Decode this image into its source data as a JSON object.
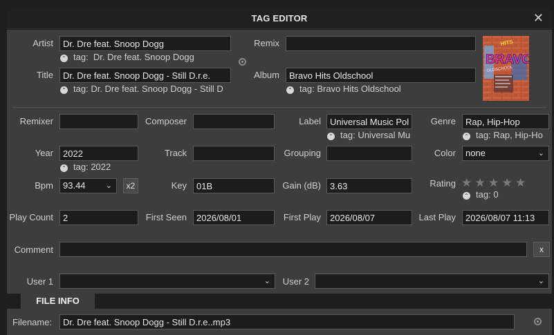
{
  "window": {
    "title": "TAG EDITOR",
    "close_glyph": "✕"
  },
  "tag_prefix": "tag:",
  "fields": {
    "artist": {
      "label": "Artist",
      "value": "Dr. Dre feat. Snoop Dogg",
      "tag": "Dr. Dre feat. Snoop Dogg"
    },
    "remix": {
      "label": "Remix",
      "value": ""
    },
    "title": {
      "label": "Title",
      "value": "Dr. Dre feat. Snoop Dogg - Still D.r.e.",
      "tag": "Dr. Dre feat. Snoop Dogg - Still D"
    },
    "album": {
      "label": "Album",
      "value": "Bravo Hits Oldschool",
      "tag": "Bravo Hits Oldschool"
    },
    "remixer": {
      "label": "Remixer",
      "value": ""
    },
    "composer": {
      "label": "Composer",
      "value": ""
    },
    "label": {
      "label": "Label",
      "value": "Universal Music Pol",
      "tag": "Universal Mu"
    },
    "genre": {
      "label": "Genre",
      "value": "Rap, Hip-Hop",
      "tag": "Rap, Hip-Ho"
    },
    "year": {
      "label": "Year",
      "value": "2022",
      "tag": "2022"
    },
    "track": {
      "label": "Track",
      "value": ""
    },
    "grouping": {
      "label": "Grouping",
      "value": ""
    },
    "color": {
      "label": "Color",
      "value": "none"
    },
    "bpm": {
      "label": "Bpm",
      "value": "93.44",
      "x2": "x2"
    },
    "key": {
      "label": "Key",
      "value": "01B"
    },
    "gain": {
      "label": "Gain (dB)",
      "value": "3.63"
    },
    "rating": {
      "label": "Rating",
      "stars": 0,
      "max_stars": 5,
      "tag": "0"
    },
    "play_count": {
      "label": "Play Count",
      "value": "2"
    },
    "first_seen": {
      "label": "First Seen",
      "value": "2026/08/01"
    },
    "first_play": {
      "label": "First Play",
      "value": "2026/08/07"
    },
    "last_play": {
      "label": "Last Play",
      "value": "2026/08/07 11:13"
    },
    "comment": {
      "label": "Comment",
      "value": "",
      "clear": "x"
    },
    "user1": {
      "label": "User 1",
      "value": ""
    },
    "user2": {
      "label": "User 2",
      "value": ""
    }
  },
  "file_info": {
    "tab_label": "FILE INFO",
    "filename_label": "Filename:",
    "filename": "Dr. Dre feat. Snoop Dogg - Still D.r.e..mp3"
  },
  "icons": {
    "tag": "chevron-up-circle-icon",
    "dropdown": "chevron-down-icon",
    "star": "star-icon",
    "cover": "album-cover-image"
  },
  "cover": {
    "hits": "HITS",
    "brand": "BRAVO",
    "sub": "OLDSCHOOL"
  },
  "colors": {
    "panel": "#3d3d3d",
    "field_bg": "#1c1c1c",
    "frame": "#1e1e1e",
    "star_off": "#7a7a7a"
  }
}
